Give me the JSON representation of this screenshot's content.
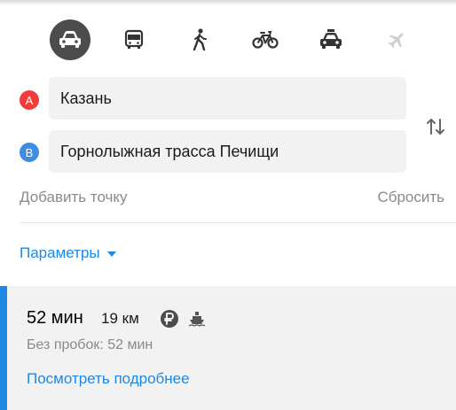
{
  "transport_modes": [
    {
      "name": "car",
      "active": true
    },
    {
      "name": "bus",
      "active": false
    },
    {
      "name": "walk",
      "active": false
    },
    {
      "name": "bike",
      "active": false
    },
    {
      "name": "taxi",
      "active": false
    },
    {
      "name": "plane",
      "active": false
    }
  ],
  "route_points": {
    "a": {
      "marker": "A",
      "value": "Казань"
    },
    "b": {
      "marker": "B",
      "value": "Горнолыжная трасса Печищи"
    }
  },
  "actions": {
    "add_point": "Добавить точку",
    "reset": "Сбросить"
  },
  "parameters": {
    "label": "Параметры"
  },
  "route": {
    "time": "52 мин",
    "distance": "19 км",
    "no_traffic": "Без пробок: 52 мин",
    "details_link": "Посмотреть подробнее",
    "icons": [
      "paid-road-icon",
      "ferry-icon"
    ]
  },
  "colors": {
    "accent": "#1e88e5",
    "marker_a": "#f23c3c",
    "marker_b": "#3d8de3",
    "active_mode": "#4c4c4c"
  }
}
